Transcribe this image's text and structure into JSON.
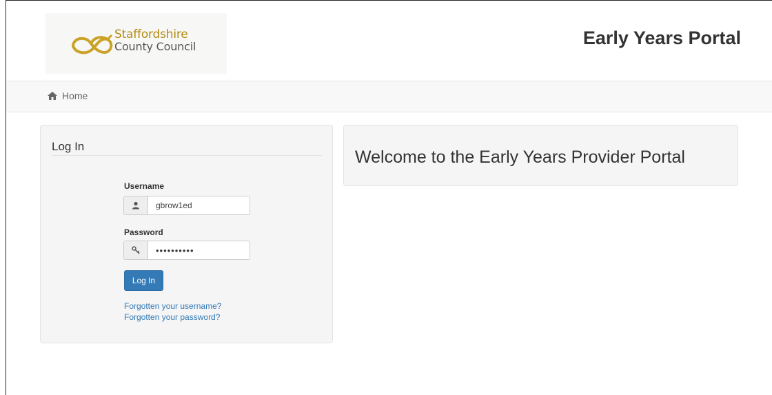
{
  "header": {
    "logo": {
      "line1": "Staffordshire",
      "line2": "County Council"
    },
    "title": "Early Years Portal"
  },
  "nav": {
    "home_icon": "home-icon",
    "home_label": "Home"
  },
  "login": {
    "title": "Log In",
    "username_label": "Username",
    "username_icon": "user-icon",
    "username_value": "gbrow1ed",
    "password_label": "Password",
    "password_icon": "key-icon",
    "password_value": "••••••••••",
    "submit_label": "Log In",
    "forgot_username": "Forgotten your username?",
    "forgot_password": "Forgotten your password?"
  },
  "welcome": {
    "text": "Welcome to the Early Years Provider Portal"
  },
  "colors": {
    "primary": "#337ab7",
    "logo_gold": "#b38a10",
    "panel_bg": "#f5f5f5"
  }
}
